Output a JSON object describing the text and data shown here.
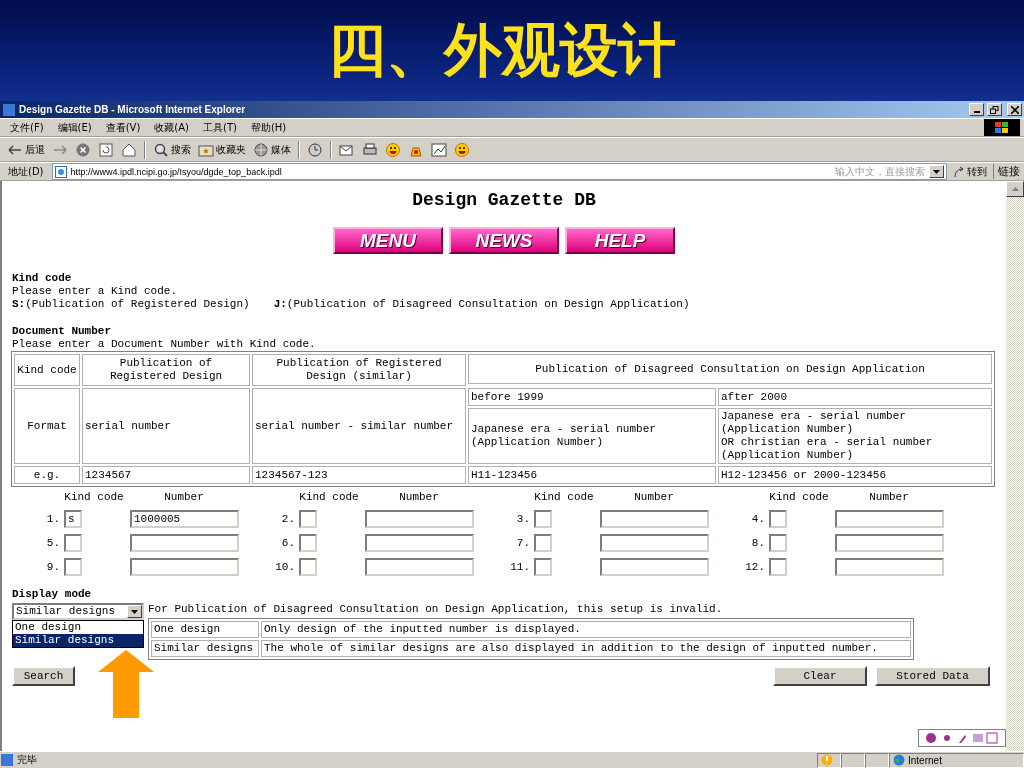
{
  "slide_title": "四、外观设计",
  "window": {
    "title": "Design Gazette DB - Microsoft Internet Explorer"
  },
  "menu": [
    "文件(F)",
    "编辑(E)",
    "查看(V)",
    "收藏(A)",
    "工具(T)",
    "帮助(H)"
  ],
  "toolbar": [
    {
      "kind": "back",
      "label": "后退"
    },
    {
      "kind": "forward"
    },
    {
      "kind": "stop"
    },
    {
      "kind": "refresh"
    },
    {
      "kind": "home"
    },
    {
      "kind": "search",
      "label": "搜索"
    },
    {
      "kind": "favorites",
      "label": "收藏夹"
    },
    {
      "kind": "media",
      "label": "媒体"
    },
    {
      "kind": "history"
    },
    {
      "kind": "mail"
    },
    {
      "kind": "print"
    },
    {
      "kind": "smiley"
    },
    {
      "kind": "bag"
    },
    {
      "kind": "chart"
    },
    {
      "kind": "smiley"
    }
  ],
  "address": {
    "label": "地址(D)",
    "value": "http://www4.ipdl.ncipi.go.jp/Isyou/dgde_top_back.ipdl",
    "search_hint": "输入中文，直接搜索",
    "go": "转到",
    "links": "链接"
  },
  "page": {
    "heading": "Design Gazette DB",
    "nav_buttons": [
      "MENU",
      "NEWS",
      "HELP"
    ],
    "kind_code": {
      "title": "Kind code",
      "instruction": "Please enter a Kind code.",
      "options": [
        {
          "code": "S:",
          "text": "(Publication of Registered Design)"
        },
        {
          "code": "J:",
          "text": "(Publication of Disagreed Consultation on Design Application)"
        }
      ]
    },
    "document_number": {
      "title": "Document Number",
      "instruction": "Please enter a Document Number with Kind code."
    },
    "table": {
      "header": [
        "Kind code",
        "Publication of Registered Design",
        "Publication of Registered Design (similar)",
        "Publication of Disagreed Consultation on Design Application"
      ],
      "subheader": [
        "before 1999",
        "after 2000"
      ],
      "format_row": {
        "label": "Format",
        "cells": [
          "serial number",
          "serial number - similar number",
          "Japanese era - serial number\n(Application Number)",
          "Japanese era - serial number\n(Application Number)\nOR christian era - serial number\n(Application Number)"
        ]
      },
      "example_row": {
        "label": "e.g.",
        "cells": [
          "1234567",
          "1234567-123",
          "H11-123456",
          "H12-123456 or 2000-123456"
        ]
      }
    },
    "entry_headers": [
      {
        "kind_code": "Kind code",
        "number": "Number"
      },
      {
        "kind_code": "Kind code",
        "number": "Number"
      },
      {
        "kind_code": "Kind code",
        "number": "Number"
      },
      {
        "kind_code": "Kind code",
        "number": "Number"
      }
    ],
    "entries": [
      {
        "index": "1.",
        "kind_code": "s",
        "number": "1000005"
      },
      {
        "index": "2."
      },
      {
        "index": "3."
      },
      {
        "index": "4."
      },
      {
        "index": "5."
      },
      {
        "index": "6."
      },
      {
        "index": "7."
      },
      {
        "index": "8."
      },
      {
        "index": "9."
      },
      {
        "index": "10."
      },
      {
        "index": "11."
      },
      {
        "index": "12."
      }
    ],
    "display_mode": {
      "title": "Display mode",
      "select": {
        "value": "Similar designs",
        "expanded": true,
        "options": [
          {
            "label": "One design",
            "selected": false
          },
          {
            "label": "Similar designs",
            "selected": true
          }
        ]
      },
      "note": "For Publication of Disagreed Consultation on Design Application, this setup is invalid.",
      "modes": [
        {
          "name": "One design",
          "description": "Only design of the inputted number is displayed."
        },
        {
          "name": "Similar designs",
          "description": "The whole of similar designs are also displayed in addition to the design of inputted number."
        }
      ]
    },
    "buttons": {
      "search": "Search",
      "clear": "Clear",
      "stored": "Stored Data"
    }
  },
  "status_bar": {
    "text": "完毕",
    "zone": "Internet"
  }
}
